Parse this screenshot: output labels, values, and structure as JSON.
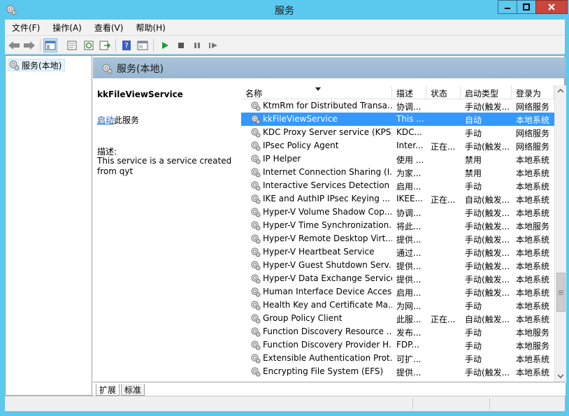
{
  "window": {
    "title": "服务"
  },
  "menu": [
    "文件(F)",
    "操作(A)",
    "查看(V)",
    "帮助(H)"
  ],
  "toolbar": {
    "icons": [
      "back-arrow-icon",
      "forward-arrow-icon",
      "show-tree-icon",
      "properties-icon",
      "refresh-icon",
      "export-icon",
      "help-icon",
      "console-icon",
      "play-icon",
      "stop-icon",
      "pause-icon",
      "restart-icon"
    ]
  },
  "tree": {
    "root": "服务(本地)"
  },
  "header": {
    "title": "服务(本地)"
  },
  "detail": {
    "service_name": "kkFileViewService",
    "start_link": "启动",
    "start_suffix": "此服务",
    "desc_label": "描述:",
    "desc_text": "This service is a service created from qyt"
  },
  "columns": {
    "name": "名称",
    "desc": "描述",
    "status": "状态",
    "start": "启动类型",
    "logon": "登录为"
  },
  "rows": [
    {
      "name": "KtmRm for Distributed Transa...",
      "desc": "协调...",
      "status": "",
      "start": "手动(触发...",
      "logon": "网络服务"
    },
    {
      "name": "kkFileViewService",
      "desc": "This ...",
      "status": "",
      "start": "自动",
      "logon": "本地系统"
    },
    {
      "name": "KDC Proxy Server service (KPS)",
      "desc": "KDC...",
      "status": "",
      "start": "手动",
      "logon": "网络服务"
    },
    {
      "name": "IPsec Policy Agent",
      "desc": "Inter...",
      "status": "正在...",
      "start": "手动(触发...",
      "logon": "网络服务"
    },
    {
      "name": "IP Helper",
      "desc": "使用 ...",
      "status": "",
      "start": "禁用",
      "logon": "本地系统"
    },
    {
      "name": "Internet Connection Sharing (I...",
      "desc": "为家...",
      "status": "",
      "start": "禁用",
      "logon": "本地系统"
    },
    {
      "name": "Interactive Services Detection",
      "desc": "启用...",
      "status": "",
      "start": "手动",
      "logon": "本地系统"
    },
    {
      "name": "IKE and AuthIP IPsec Keying ...",
      "desc": "IKEE...",
      "status": "正在...",
      "start": "自动(触发...",
      "logon": "本地系统"
    },
    {
      "name": "Hyper-V Volume Shadow Cop...",
      "desc": "协调...",
      "status": "",
      "start": "手动(触发...",
      "logon": "本地系统"
    },
    {
      "name": "Hyper-V Time Synchronization...",
      "desc": "将此...",
      "status": "",
      "start": "手动(触发...",
      "logon": "本地服务"
    },
    {
      "name": "Hyper-V Remote Desktop Virt...",
      "desc": "提供...",
      "status": "",
      "start": "手动(触发...",
      "logon": "本地系统"
    },
    {
      "name": "Hyper-V Heartbeat Service",
      "desc": "通过...",
      "status": "",
      "start": "手动(触发...",
      "logon": "本地系统"
    },
    {
      "name": "Hyper-V Guest Shutdown Serv...",
      "desc": "提供...",
      "status": "",
      "start": "手动(触发...",
      "logon": "本地系统"
    },
    {
      "name": "Hyper-V Data Exchange Service",
      "desc": "提供...",
      "status": "",
      "start": "手动(触发...",
      "logon": "本地系统"
    },
    {
      "name": "Human Interface Device Access",
      "desc": "启用...",
      "status": "",
      "start": "手动(触发...",
      "logon": "本地系统"
    },
    {
      "name": "Health Key and Certificate Ma...",
      "desc": "为网...",
      "status": "",
      "start": "手动",
      "logon": "本地系统"
    },
    {
      "name": "Group Policy Client",
      "desc": "此服...",
      "status": "正在...",
      "start": "自动(触发...",
      "logon": "本地系统"
    },
    {
      "name": "Function Discovery Resource ...",
      "desc": "发布...",
      "status": "",
      "start": "手动",
      "logon": "本地服务"
    },
    {
      "name": "Function Discovery Provider H...",
      "desc": "FDP...",
      "status": "",
      "start": "手动",
      "logon": "本地服务"
    },
    {
      "name": "Extensible Authentication Prot...",
      "desc": "可扩...",
      "status": "",
      "start": "手动",
      "logon": "本地系统"
    },
    {
      "name": "Encrypting File System (EFS)",
      "desc": "提供...",
      "status": "",
      "start": "手动(触发...",
      "logon": "本地系统"
    }
  ],
  "selected_row": 1,
  "tabs": [
    "扩展",
    "标准"
  ]
}
